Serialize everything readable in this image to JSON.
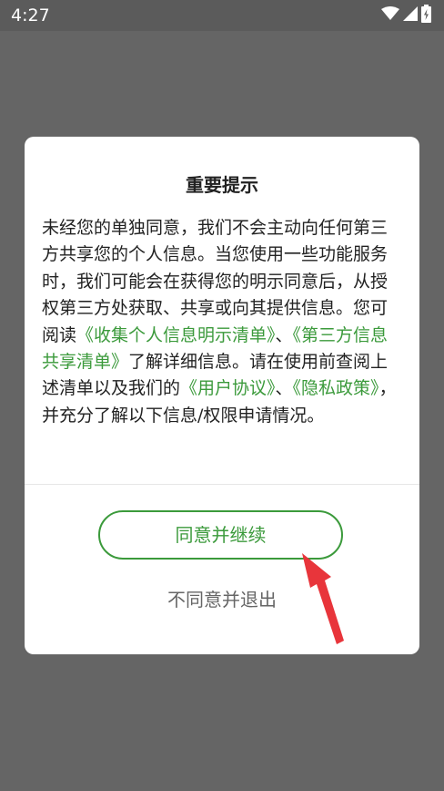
{
  "status_bar": {
    "time": "4:27",
    "icons": [
      "wifi-icon",
      "signal-icon",
      "battery-icon"
    ]
  },
  "dialog": {
    "title": "重要提示",
    "body": {
      "intro": "未经您的单独同意，我们不会主动向任何第三方共享您的个人信息。当您使用一些功能服务时，我们可能会在获得您的明示同意后，从授权第三方处获取、共享或向其提供信息。您可阅读",
      "link_collect": "《收集个人信息明示清单》",
      "sep1": "、",
      "link_third_party": "《第三方信息共享清单》",
      "middle": "了解详细信息。请在使用前查阅上述清单以及我们的",
      "link_user_agreement": "《用户协议》",
      "sep2": "、",
      "link_privacy": "《隐私政策》",
      "outro": "，并充分了解以下信息/权限申请情况。"
    },
    "agree_label": "同意并继续",
    "decline_label": "不同意并退出"
  },
  "colors": {
    "accent": "#3b9a3b",
    "overlay": "#656565",
    "annotation_arrow": "#e8353b"
  }
}
